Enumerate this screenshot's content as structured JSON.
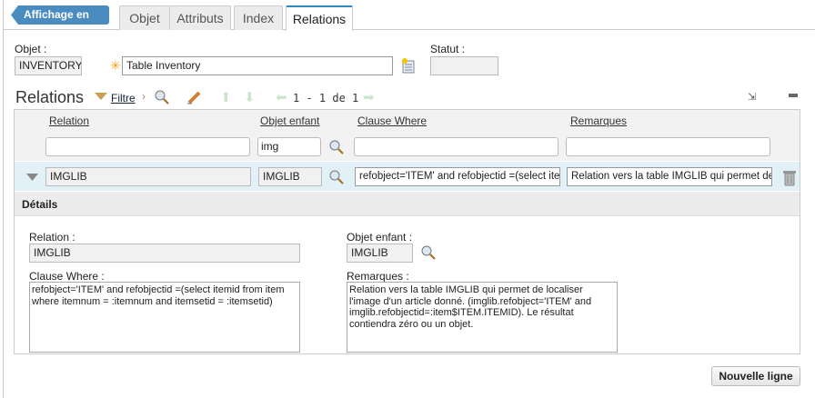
{
  "nav": {
    "back_label": "Affichage en liste",
    "tabs": [
      {
        "label": "Objet"
      },
      {
        "label": "Attributs"
      },
      {
        "label": "Index"
      },
      {
        "label": "Relations",
        "active": true
      }
    ]
  },
  "header": {
    "objet_label": "Objet :",
    "objet_value": "INVENTORY",
    "description_value": "Table Inventory",
    "statut_label": "Statut :",
    "statut_value": ""
  },
  "relations": {
    "title": "Relations",
    "filter_label": "Filtre",
    "pagination": "1 - 1 de 1",
    "columns": [
      "Relation",
      "Objet enfant",
      "Clause Where",
      "Remarques"
    ],
    "filters": {
      "relation": "",
      "objet_enfant": "img",
      "clause": "",
      "remarques": ""
    },
    "rows": [
      {
        "relation": "IMGLIB",
        "objet_enfant": "IMGLIB",
        "clause": "refobject='ITEM' and refobjectid =(select item",
        "remarques": "Relation vers la table IMGLIB qui permet de l"
      }
    ]
  },
  "details": {
    "title": "Détails",
    "relation_label": "Relation :",
    "relation_value": "IMGLIB",
    "objet_enfant_label": "Objet enfant :",
    "objet_enfant_value": "IMGLIB",
    "clause_label": "Clause Where :",
    "clause_value": "refobject='ITEM' and refobjectid =(select itemid from item where itemnum = :itemnum and itemsetid = :itemsetid)",
    "remarques_label": "Remarques :",
    "remarques_value": "Relation vers la table IMGLIB qui permet de localiser l'image d'un article donné. (imglib.refobject='ITEM' and imglib.refobjectid=:item$ITEM.ITEMID). Le résultat contiendra zéro ou un objet."
  },
  "footer": {
    "new_row_label": "Nouvelle ligne"
  },
  "colors": {
    "accent": "#2b8ac4",
    "back_button": "#4a8cbf",
    "selected_row": "#e2f0f8"
  }
}
